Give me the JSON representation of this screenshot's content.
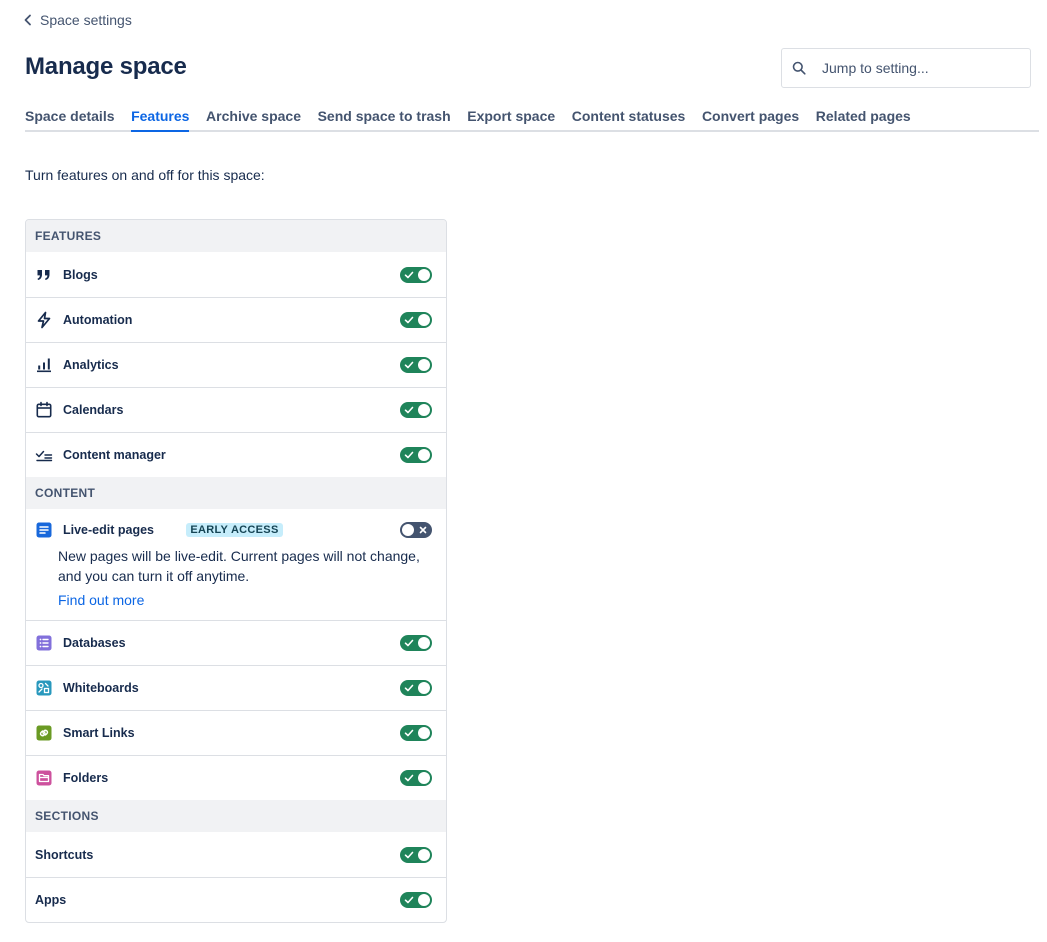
{
  "header": {
    "back_label": "Space settings",
    "title": "Manage space",
    "search_placeholder": "Jump to setting..."
  },
  "tabs": [
    {
      "label": "Space details",
      "active": false
    },
    {
      "label": "Features",
      "active": true
    },
    {
      "label": "Archive space",
      "active": false
    },
    {
      "label": "Send space to trash",
      "active": false
    },
    {
      "label": "Export space",
      "active": false
    },
    {
      "label": "Content statuses",
      "active": false
    },
    {
      "label": "Convert pages",
      "active": false
    },
    {
      "label": "Related pages",
      "active": false
    }
  ],
  "intro_text": "Turn features on and off for this space:",
  "sections": {
    "features": {
      "heading": "FEATURES",
      "items": [
        {
          "label": "Blogs",
          "icon": "quote-icon",
          "enabled": true
        },
        {
          "label": "Automation",
          "icon": "lightning-icon",
          "enabled": true
        },
        {
          "label": "Analytics",
          "icon": "bar-chart-icon",
          "enabled": true
        },
        {
          "label": "Calendars",
          "icon": "calendar-icon",
          "enabled": true
        },
        {
          "label": "Content manager",
          "icon": "checklist-icon",
          "enabled": true
        }
      ]
    },
    "content": {
      "heading": "CONTENT",
      "live_edit": {
        "label": "Live-edit pages",
        "badge": "EARLY ACCESS",
        "enabled": false,
        "description": "New pages will be live-edit. Current pages will not change, and you can turn it off anytime.",
        "link": "Find out more"
      },
      "items": [
        {
          "label": "Databases",
          "icon": "database-icon",
          "enabled": true
        },
        {
          "label": "Whiteboards",
          "icon": "whiteboard-icon",
          "enabled": true
        },
        {
          "label": "Smart Links",
          "icon": "link-icon",
          "enabled": true
        },
        {
          "label": "Folders",
          "icon": "folder-icon",
          "enabled": true
        }
      ]
    },
    "sections": {
      "heading": "SECTIONS",
      "items": [
        {
          "label": "Shortcuts",
          "enabled": true
        },
        {
          "label": "Apps",
          "enabled": true
        }
      ]
    }
  },
  "colors": {
    "accent": "#0c66e4",
    "toggle_on": "#1f845a",
    "toggle_off": "#44546f",
    "badge_bg": "#c6edfb"
  }
}
